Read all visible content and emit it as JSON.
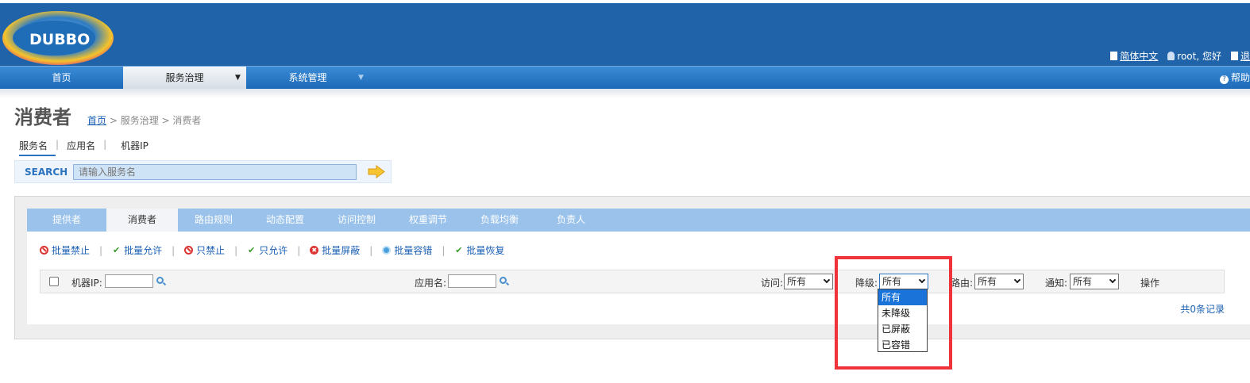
{
  "header": {
    "logo_text": "DUBBO",
    "language_link": "简体中文",
    "user_greeting": "root, 您好",
    "logout_link": "退"
  },
  "nav": {
    "items": [
      {
        "label": "首页"
      },
      {
        "label": "服务治理",
        "arrow": "▼"
      },
      {
        "label": "系统管理",
        "arrow": "▼"
      }
    ],
    "help": "帮助"
  },
  "page": {
    "title": "消费者",
    "breadcrumb_home": "首页",
    "breadcrumb_rest": " > 服务治理 > 消费者"
  },
  "search": {
    "tabs": [
      "服务名",
      "应用名",
      "机器IP"
    ],
    "separator": "|",
    "label": "SEARCH",
    "placeholder": "请输入服务名"
  },
  "tabs": [
    "提供者",
    "消费者",
    "路由规则",
    "动态配置",
    "访问控制",
    "权重调节",
    "负载均衡",
    "负责人"
  ],
  "actions": [
    {
      "label": "批量禁止",
      "icon": "ban-icon"
    },
    {
      "label": "批量允许",
      "icon": "check-icon"
    },
    {
      "label": "只禁止",
      "icon": "ban-icon"
    },
    {
      "label": "只允许",
      "icon": "check-icon"
    },
    {
      "label": "批量屏蔽",
      "icon": "mask-icon"
    },
    {
      "label": "批量容错",
      "icon": "gear-icon"
    },
    {
      "label": "批量恢复",
      "icon": "check-icon"
    }
  ],
  "filter": {
    "machine_ip_label": "机器IP:",
    "app_name_label": "应用名:",
    "access_label": "访问:",
    "access_value": "所有",
    "degrade_label": "降级:",
    "degrade_value": "所有",
    "route_label": "路由:",
    "route_value": "所有",
    "notify_label": "通知:",
    "notify_value": "所有",
    "operation_label": "操作"
  },
  "dropdown": {
    "options": [
      "所有",
      "未降级",
      "已屏蔽",
      "已容错"
    ],
    "selected_index": 0
  },
  "total_records": "共0条记录",
  "colors": {
    "header_bg": "#2163a9",
    "tab_bar": "#9ac2ea",
    "link": "#1a5fb4",
    "highlight": "#f0333a"
  }
}
